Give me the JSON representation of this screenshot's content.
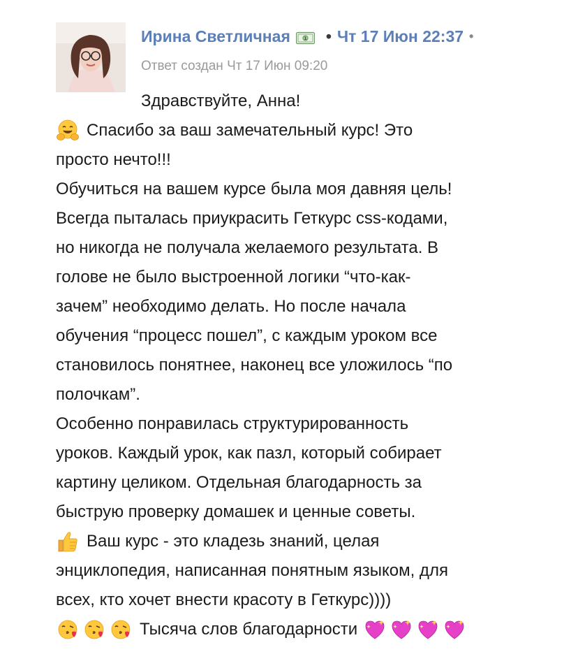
{
  "header": {
    "author": "Ирина Светличная",
    "separator": "•",
    "datetime": "Чт 17 Июн 22:37",
    "trailing": "•"
  },
  "subheader": "Ответ создан Чт 17 Июн 09:20",
  "body": {
    "line1": "Здравствуйте, Анна!",
    "line2": "Спасибо за ваш замечательный курс! Это",
    "line3": "просто нечто!!!",
    "line4": "Обучиться на вашем курсе была моя давняя цель!",
    "line5": "Всегда пыталась приукрасить Геткурс css-кодами,",
    "line6": "но никогда не получала желаемого результата. В",
    "line7": "голове не было выстроенной логики “что-как-",
    "line8": "зачем” необходимо делать. Но после начала",
    "line9": "обучения “процесс пошел”, с каждым уроком все",
    "line10": "становилось понятнее, наконец все уложилось “по",
    "line11": "полочкам”.",
    "line12": "Особенно понравилась структурированность",
    "line13": "уроков. Каждый урок, как пазл, который собирает",
    "line14": "картину целиком. Отдельная благодарность за",
    "line15": "быструю проверку домашек и ценные советы.",
    "line16": "Ваш курс - это кладезь знаний, целая",
    "line17": "энциклопедия, написанная понятным языком, для",
    "line18": "всех, кто хочет внести красоту в Геткурс))))",
    "line19": "Тысяча слов благодарности"
  },
  "icons": {
    "money": "dollar-banknote-icon",
    "hug": "hugging-face-emoji",
    "thumbs": "thumbs-up-emoji",
    "kiss": "face-blowing-kiss-emoji",
    "heart": "sparkling-heart-emoji"
  },
  "colors": {
    "author_link": "#5b7fb6",
    "meta_gray": "#9a9a9a",
    "text": "#1b1b1b",
    "heart": "#e640c8"
  }
}
